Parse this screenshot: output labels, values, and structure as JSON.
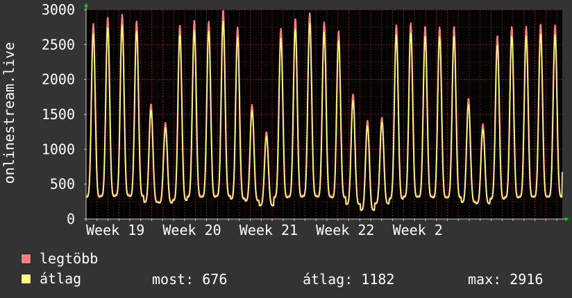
{
  "chart_data": {
    "type": "line",
    "ylabel": "onlinestream.live",
    "ylim": [
      0,
      3000
    ],
    "yticks": [
      0,
      500,
      1000,
      1500,
      2000,
      2500,
      3000
    ],
    "xticks": [
      "Week 19",
      "Week 20",
      "Week 21",
      "Week 22",
      "Week 2"
    ],
    "grid": true,
    "x_unit": "day",
    "x_range_days": [
      0,
      43.5
    ],
    "xtick_day_positions": [
      0,
      7,
      14,
      21,
      28
    ],
    "daily_peaks": [
      2800,
      2900,
      2930,
      2840,
      1650,
      1380,
      2780,
      2850,
      2830,
      3000,
      2750,
      1640,
      1250,
      2730,
      2870,
      2960,
      2820,
      2700,
      1790,
      1410,
      1460,
      2780,
      2810,
      2770,
      2750,
      2760,
      1730,
      1360,
      2630,
      2760,
      2760,
      2800,
      2780
    ],
    "daily_troughs": [
      330,
      340,
      350,
      340,
      250,
      240,
      280,
      330,
      330,
      340,
      300,
      270,
      200,
      320,
      330,
      340,
      330,
      320,
      220,
      130,
      230,
      300,
      330,
      330,
      320,
      320,
      250,
      230,
      300,
      320,
      330,
      330,
      330
    ],
    "last_value": 676,
    "series": [
      {
        "name": "legtöbb",
        "color": "#f47f7f"
      },
      {
        "name": "átlag",
        "color": "#ffff80"
      }
    ]
  },
  "legend": {
    "max_label": "legtöbb",
    "avg_label": "átlag"
  },
  "stats": {
    "current": "most: 676",
    "average": "átlag: 1182",
    "maximum": "max: 2916"
  },
  "colors": {
    "background": "#333333",
    "plot_bg": "#000000",
    "grid": "#7a2020",
    "axis": "#cccccc",
    "arrow": "#00cc00",
    "max_series": "#f47f7f",
    "avg_series": "#ffff80"
  }
}
